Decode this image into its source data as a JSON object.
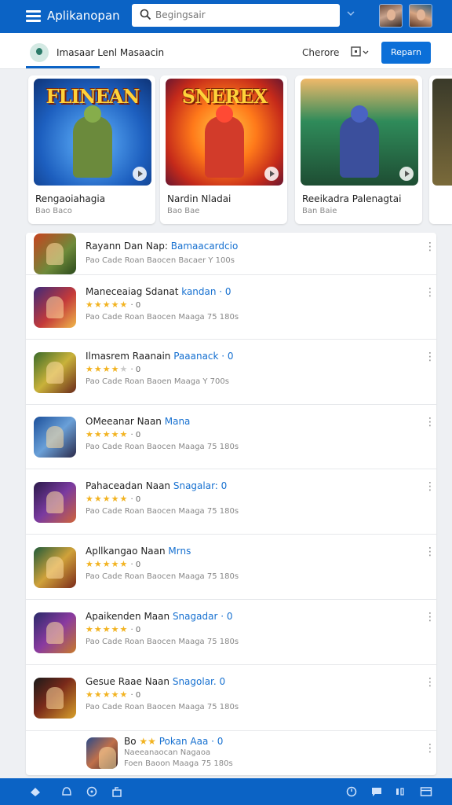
{
  "header": {
    "title": "Aplikanopan",
    "search_placeholder": "Begingsair",
    "avatars": [
      "avatar-user-1",
      "avatar-user-2"
    ]
  },
  "subheader": {
    "label": "Imasaar Lenl Masaacin",
    "sort_label": "Cherore",
    "action_label": "Reparn"
  },
  "featured": [
    {
      "art_title": "FLINEAN",
      "title": "Rengaoiahagia",
      "subtitle": "Bao Baco"
    },
    {
      "art_title": "SNEREX",
      "title": "Nardin Nladai",
      "subtitle": "Bao Bae"
    },
    {
      "art_title": "",
      "title": "Reeikadra Palenagtai",
      "subtitle": "Ban Baie"
    }
  ],
  "list": [
    {
      "name": "Rayann Dan Nap:",
      "highlight": "Bamaacardcio",
      "rating": 0,
      "rating_label": "",
      "meta": "Pao Cade Roan Baocen Bacaer  Y 100s"
    },
    {
      "name": "Maneceaiag Sdanat",
      "highlight": "kandan · 0",
      "rating": 4.5,
      "rating_label": "· 0",
      "meta": "Pao Cade Roan Baocen Maaga 75 180s"
    },
    {
      "name": "Ilmasrem Raanain",
      "highlight": "Paaanack · 0",
      "rating": 4,
      "rating_label": "· 0",
      "meta": "Pao Cade Roan Baoen Maaga  Y 700s"
    },
    {
      "name": "OMeeanar Naan",
      "highlight": "Mana",
      "rating": 4.5,
      "rating_label": "· 0",
      "meta": "Pao Cade Roan Baocen Maaga 75 180s"
    },
    {
      "name": "Pahaceadan Naan",
      "highlight": "Snagalar: 0",
      "rating": 4.5,
      "rating_label": "· 0",
      "meta": "Pao Cade Roan Baocen Maaga 75 180s"
    },
    {
      "name": "Apllkangao Naan",
      "highlight": "Mrns",
      "rating": 4.5,
      "rating_label": "· 0",
      "meta": "Pao Cade Roan Baocen Maaga 75 180s"
    },
    {
      "name": "Apaikenden Maan",
      "highlight": "Snagadar · 0",
      "rating": 4.5,
      "rating_label": "· 0",
      "meta": "Pao Cade Roan Baocen Maaga 75 180s"
    },
    {
      "name": "Gesue Raae Naan",
      "highlight": "Snagolar. 0",
      "rating": 4.5,
      "rating_label": "· 0",
      "meta": "Pao Cade Roan Baocen Maaga 75 180s"
    },
    {
      "name": "Bo",
      "highlight": "Pokan Aaa · 0",
      "rating": 2,
      "rating_label": "",
      "meta": "Naeeanaocan Nagaoa",
      "meta2": "Foen Baoon Maaga 75 180s"
    }
  ],
  "colors": {
    "accent": "#0b63c5",
    "link": "#1670d0",
    "star": "#f2b321"
  }
}
